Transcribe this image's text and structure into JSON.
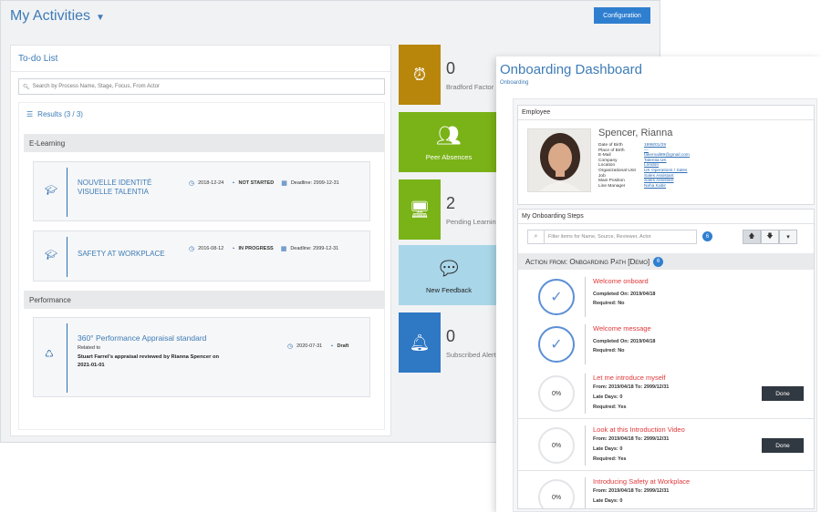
{
  "main": {
    "title": "My Activities",
    "config_label": "Configuration"
  },
  "todo": {
    "heading": "To-do List",
    "search_placeholder": "Search by Process Name, Stage, Focus, From Actor",
    "results_label": "Results (3 / 3)",
    "categories": [
      "E-Learning",
      "Performance"
    ],
    "items": [
      {
        "name1": "NOUVELLE IDENTITÉ",
        "name2": "VISUELLE TALENTIA",
        "date": "2018-12-24",
        "status": "NOT STARTED",
        "deadline": "Deadline: 2999-12-31"
      },
      {
        "name1": "SAFETY AT WORKPLACE",
        "date": "2016-08-12",
        "status": "IN PROGRESS",
        "deadline": "Deadline: 2999-12-31"
      },
      {
        "name1": "360° Performance Appraisal standard",
        "related": "Related to",
        "desc1": "Stuart Farrel's appraisal reviewed by Rianna Spencer on",
        "desc2": "2021-01-01",
        "date": "2020-07-31",
        "status": "Draft"
      }
    ]
  },
  "tiles": [
    {
      "number": "0",
      "label": "Bradford Factor",
      "color": "#b8860b"
    },
    {
      "label": "Peer Absences",
      "color": "#7ab317"
    },
    {
      "number": "2",
      "label": "Pending Learning",
      "color": "#7ab317"
    },
    {
      "label": "New Feedback",
      "color": "#add8e6"
    },
    {
      "number": "0",
      "label": "Subscribed Alerts",
      "color": "#2f78c4"
    }
  ],
  "onboarding": {
    "title": "Onboarding Dashboard",
    "subtitle": "Onboarding",
    "employee_heading": "Employee",
    "employee_name": "Spencer, Rianna",
    "fields": [
      {
        "k": "Date of Birth",
        "v": "1998/01/29"
      },
      {
        "k": "Place of Birth",
        "v": "—"
      },
      {
        "k": "E-Mail",
        "v": "fakemail89@gmail.com"
      },
      {
        "k": "Company",
        "v": "Talentia UK"
      },
      {
        "k": "Location",
        "v": "London"
      },
      {
        "k": "Organizational Unit",
        "v": "UK Operations / Sales"
      },
      {
        "k": "Job",
        "v": "Sales Assistant"
      },
      {
        "k": "Main Position",
        "v": "Sales Assistant"
      },
      {
        "k": "Line Manager",
        "v": "Neha Kabir"
      }
    ],
    "steps_heading": "My Onboarding Steps",
    "filter_placeholder": "Filter items for Name, Source, Reviewer, Actor",
    "filter_count": "6",
    "action_heading": "Action from: Onboarding Path [Demo]",
    "action_count": "6",
    "done_label": "Done",
    "steps": [
      {
        "name": "Welcome onboard",
        "line1": "Completed On: 2019/04/18",
        "line2": "Required: No"
      },
      {
        "name": "Welcome message",
        "line1": "Completed On: 2019/04/18",
        "line2": "Required: No"
      },
      {
        "name": "Let me introduce myself",
        "pct": "0%",
        "line1": "From: 2019/04/18 To: 2999/12/31",
        "line2": "Late Days: 0",
        "line3": "Required: Yes"
      },
      {
        "name": "Look at this Introduction Video",
        "pct": "0%",
        "line1": "From: 2019/04/18 To: 2999/12/31",
        "line2": "Late Days: 0",
        "line3": "Required: Yes"
      },
      {
        "name": "Introducing Safety at Workplace",
        "pct": "0%",
        "line1": "From: 2019/04/18 To: 2999/12/31",
        "line2": "Late Days: 0"
      }
    ]
  }
}
